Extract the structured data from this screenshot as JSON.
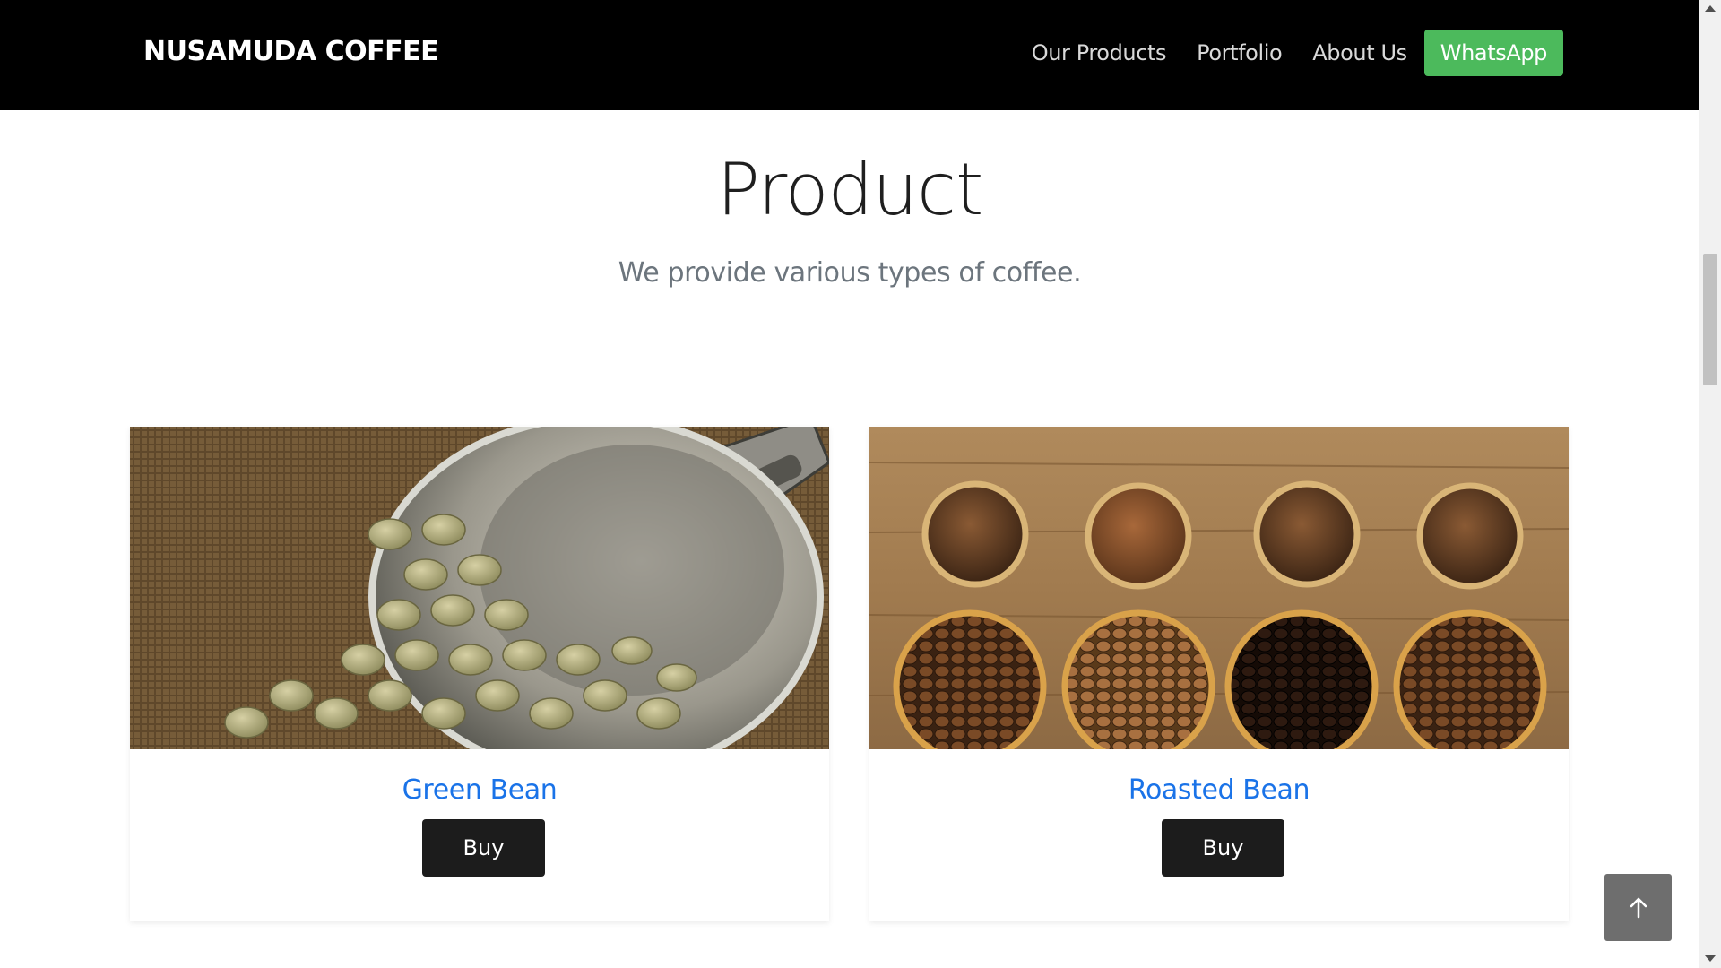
{
  "navbar": {
    "brand": "NUSAMUDA COFFEE",
    "links": [
      {
        "label": "Our Products"
      },
      {
        "label": "Portfolio"
      },
      {
        "label": "About Us"
      }
    ],
    "whatsapp_label": "WhatsApp",
    "colors": {
      "background": "#000000",
      "whatsapp": "#4cba5c"
    }
  },
  "section": {
    "title": "Product",
    "subtitle": "We provide various types of coffee."
  },
  "products": [
    {
      "name": "Green Bean",
      "button_label": "Buy",
      "image": "green-coffee-beans-in-scoop"
    },
    {
      "name": "Roasted Bean",
      "button_label": "Buy",
      "image": "roasted-beans-and-ground-coffee-bowls"
    }
  ],
  "controls": {
    "back_to_top_icon": "arrow-up-icon"
  },
  "colors": {
    "link": "#1a73e8",
    "button": "#1c1c1c"
  }
}
